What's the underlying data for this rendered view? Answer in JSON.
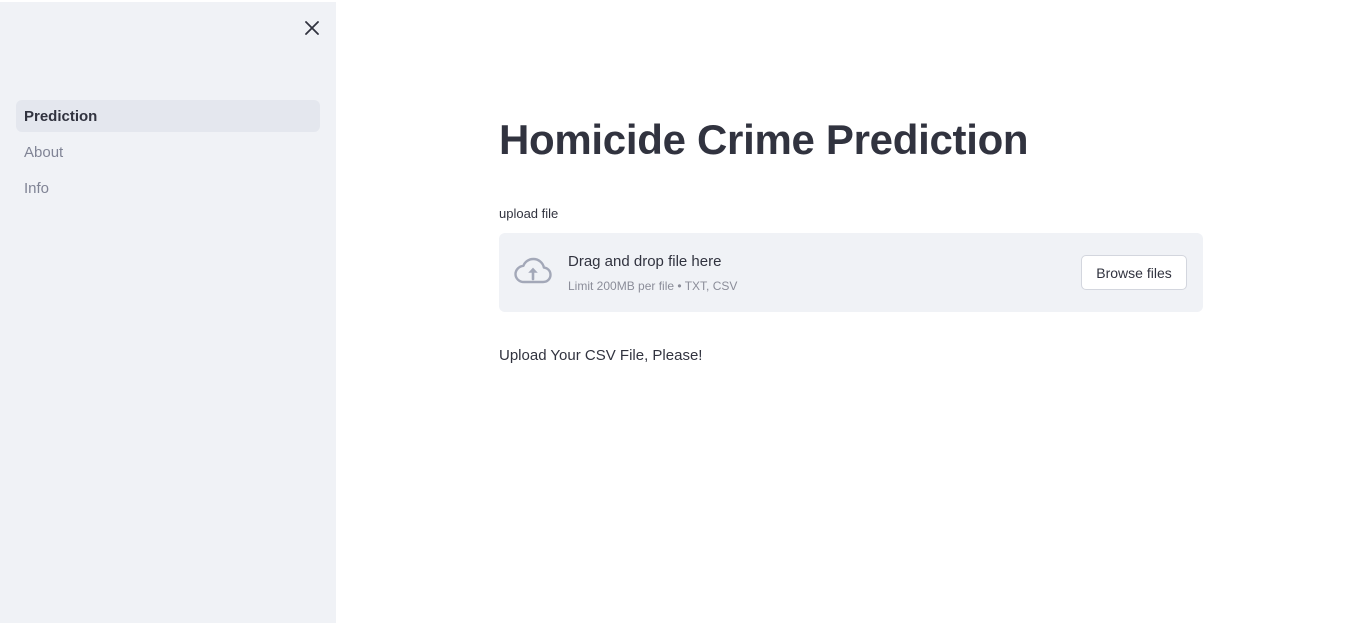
{
  "sidebar": {
    "close_icon": "close-icon",
    "items": [
      {
        "label": "Prediction",
        "active": true
      },
      {
        "label": "About",
        "active": false
      },
      {
        "label": "Info",
        "active": false
      }
    ]
  },
  "main": {
    "title": "Homicide Crime Prediction",
    "uploader": {
      "label": "upload file",
      "icon": "cloud-upload-icon",
      "drop_text": "Drag and drop file here",
      "limit_text": "Limit 200MB per file • TXT, CSV",
      "browse_label": "Browse files"
    },
    "message": "Upload Your CSV File, Please!"
  },
  "colors": {
    "sidebar_bg": "#f0f2f6",
    "active_item_bg": "#e4e7ee",
    "text": "#31333f",
    "muted_text": "#808495",
    "icon": "#a3a8b8"
  }
}
